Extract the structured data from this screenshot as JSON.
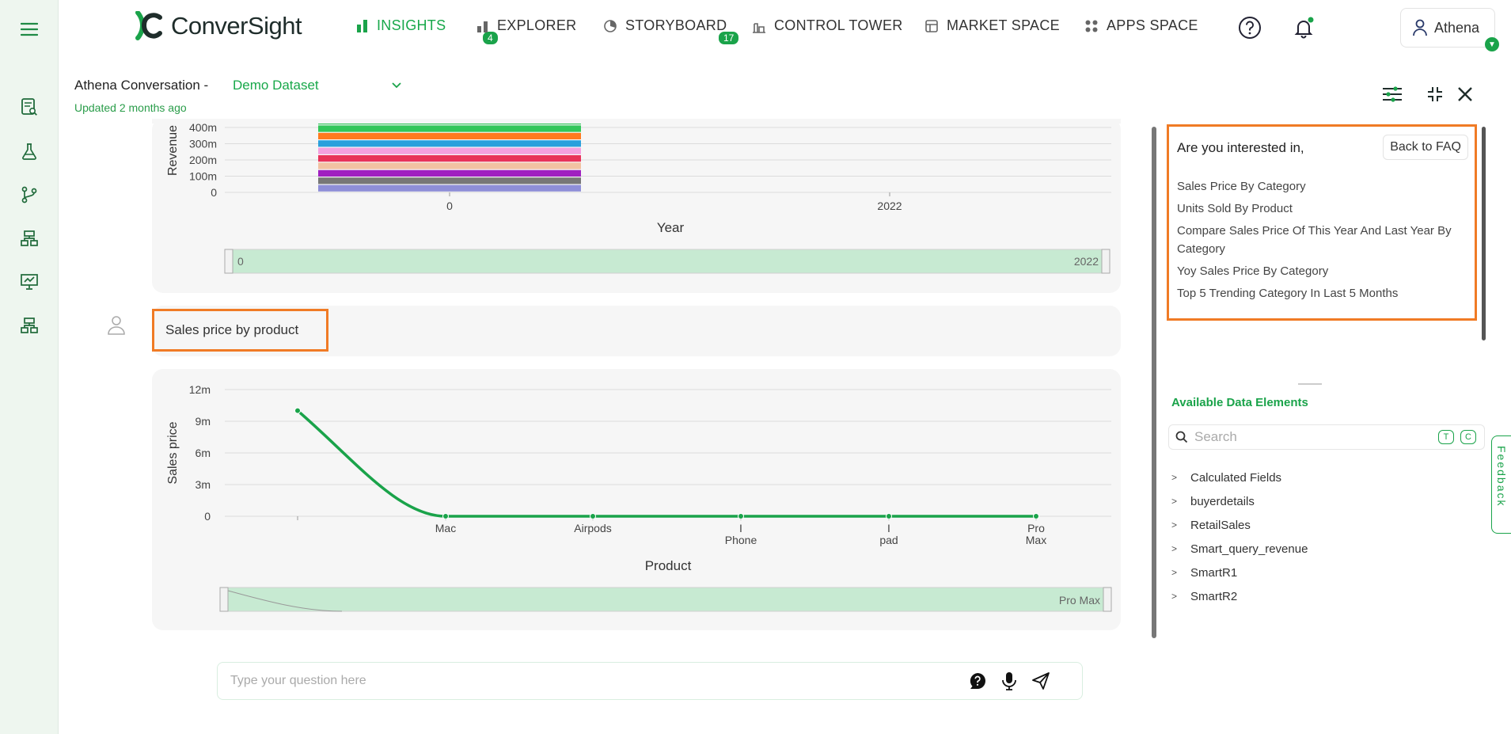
{
  "app": {
    "name": "ConverSight"
  },
  "nav": [
    {
      "label": "INSIGHTS",
      "badge": "4",
      "icon": "bar-chart-icon",
      "active": true
    },
    {
      "label": "EXPLORER",
      "badge": "",
      "icon": "explorer-icon",
      "active": false
    },
    {
      "label": "STORYBOARD",
      "badge": "17",
      "icon": "storyboard-icon",
      "active": false
    },
    {
      "label": "CONTROL TOWER",
      "badge": "",
      "icon": "tower-icon",
      "active": false
    },
    {
      "label": "MARKET SPACE",
      "badge": "",
      "icon": "market-icon",
      "active": false
    },
    {
      "label": "APPS SPACE",
      "badge": "",
      "icon": "apps-icon",
      "active": false
    }
  ],
  "user": {
    "name": "Athena"
  },
  "conversation": {
    "title": "Athena Conversation -",
    "dataset": "Demo Dataset",
    "updated": "Updated 2 months ago"
  },
  "query": {
    "text": "Sales price by product"
  },
  "suggestions": {
    "title": "Are you interested in,",
    "back_label": "Back to FAQ",
    "items": [
      "Sales Price By Category",
      "Units Sold By Product",
      "Compare Sales Price Of This Year And Last Year By Category",
      "Yoy Sales Price By Category",
      "Top 5 Trending Category In Last 5 Months"
    ]
  },
  "data_elements": {
    "title": "Available Data Elements",
    "search_placeholder": "Search",
    "t_label": "T",
    "c_label": "C",
    "items": [
      "Calculated Fields",
      "buyerdetails",
      "RetailSales",
      "Smart_query_revenue",
      "SmartR1",
      "SmartR2"
    ]
  },
  "feedback_label": "Feedback",
  "ask": {
    "placeholder": "Type your question here"
  },
  "colors": {
    "accent": "#1aa34a",
    "highlight": "#f07b25"
  },
  "chart_data": [
    {
      "type": "bar",
      "stacked": true,
      "categories": [
        "0",
        "2022"
      ],
      "xlabel": "Year",
      "ylabel": "Revenue",
      "y_ticks": [
        "0",
        "100m",
        "200m",
        "300m",
        "400m"
      ],
      "slider_labels": [
        "0",
        "2022"
      ],
      "segment_colors": [
        "#8e8ed8",
        "#777777",
        "#a020c0",
        "#f2c2a2",
        "#e8325a",
        "#f4a0e0",
        "#2aa0dc",
        "#ff7a1e",
        "#32c65a"
      ],
      "note": "chart is scrolled; only the lower part is visible"
    },
    {
      "type": "line",
      "x": [
        "",
        "Mac",
        "Airpods",
        "I Phone",
        "I pad",
        "Pro Max"
      ],
      "x_tick_labels": [
        [
          ""
        ],
        [
          "Mac"
        ],
        [
          "Airpods"
        ],
        [
          "I",
          "Phone"
        ],
        [
          "I",
          "pad"
        ],
        [
          "Pro",
          "Max"
        ]
      ],
      "values": [
        10000000,
        0,
        0,
        0,
        0,
        0
      ],
      "xlabel": "Product",
      "ylabel": "Sales price",
      "y_ticks": [
        "0",
        "3m",
        "6m",
        "9m",
        "12m"
      ],
      "ylim": [
        0,
        12000000
      ],
      "slider_end_label": "Pro Max",
      "color": "#1aa34a"
    }
  ]
}
